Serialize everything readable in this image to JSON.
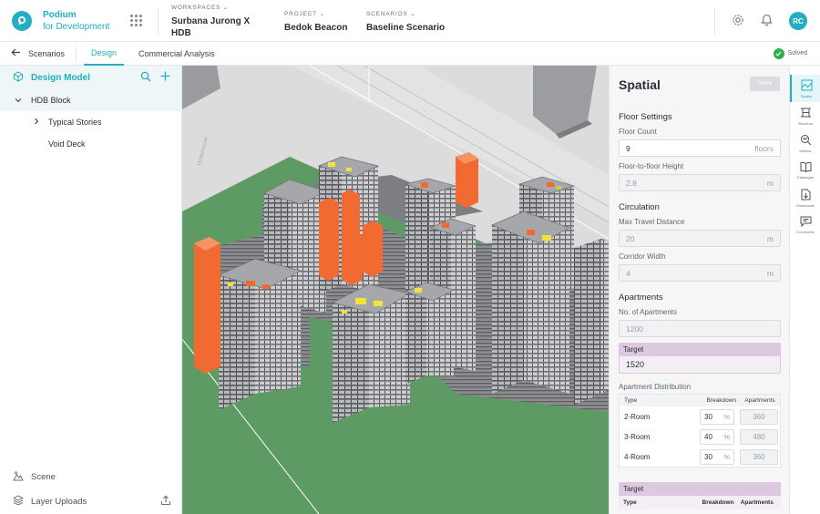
{
  "app": {
    "brand_line1": "Podium",
    "brand_line2": "for Development"
  },
  "header": {
    "workspaces": {
      "label": "WORKSPACES",
      "value": "Surbana Jurong X HDB"
    },
    "project": {
      "label": "PROJECT",
      "value": "Bedok Beacon"
    },
    "scenarios": {
      "label": "SCENARIOS",
      "value": "Baseline Scenario"
    },
    "avatar_initials": "RC"
  },
  "subbar": {
    "back_label": "Scenarios",
    "tabs": [
      "Design",
      "Commercial Analysis"
    ],
    "status": "Solved"
  },
  "left_panel": {
    "title": "Design Model",
    "tree": [
      {
        "label": "HDB Block"
      },
      {
        "label": "Typical Stories"
      },
      {
        "label": "Void Deck"
      }
    ],
    "bottom": [
      {
        "label": "Scene"
      },
      {
        "label": "Layer Uploads"
      }
    ]
  },
  "right_panel": {
    "title": "Spatial",
    "solve_label": "Solve",
    "floor_settings": {
      "section": "Floor Settings",
      "floor_count_label": "Floor Count",
      "floor_count_value": "9",
      "floor_count_unit": "floors",
      "ftf_label": "Floor-to-floor Height",
      "ftf_value": "2.8",
      "ftf_unit": "m"
    },
    "circulation": {
      "section": "Circulation",
      "max_travel_label": "Max Travel Distance",
      "max_travel_value": "20",
      "max_travel_unit": "m",
      "corridor_label": "Corridor Width",
      "corridor_value": "4",
      "corridor_unit": "m"
    },
    "apartments": {
      "section": "Apartments",
      "count_label": "No. of Apartments",
      "count_value": "1200",
      "target_label": "Target",
      "target_value": "1520",
      "distribution_label": "Apartment Distribution",
      "columns": [
        "Type",
        "Breakdown",
        "Apartments"
      ],
      "rows": [
        {
          "type": "2-Room",
          "breakdown": "30",
          "apartments": "360"
        },
        {
          "type": "3-Room",
          "breakdown": "40",
          "apartments": "480"
        },
        {
          "type": "4-Room",
          "breakdown": "30",
          "apartments": "360"
        }
      ],
      "percent": "%",
      "target2_label": "Target",
      "target2_columns": [
        "Type",
        "Breakdown",
        "Apartments"
      ]
    }
  },
  "rail": [
    {
      "label": "Spatial",
      "icon": "spatial-icon",
      "active": true
    },
    {
      "label": "Structure",
      "icon": "structure-icon"
    },
    {
      "label": "Metrics",
      "icon": "metrics-icon"
    },
    {
      "label": "Catalogue",
      "icon": "catalogue-icon"
    },
    {
      "label": "Downloads",
      "icon": "downloads-icon"
    },
    {
      "label": "Comments",
      "icon": "comments-icon"
    }
  ],
  "colors": {
    "accent": "#23aec1",
    "ground": "#5e9a63",
    "core_orange": "#f06a32",
    "unit_yellow": "#f2e23a",
    "solved_green": "#2db04c"
  }
}
